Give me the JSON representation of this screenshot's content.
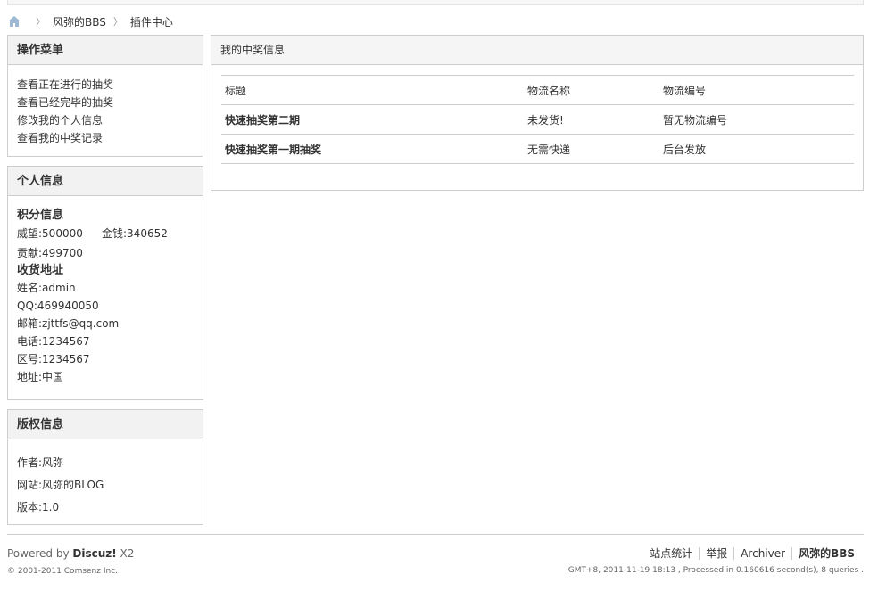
{
  "breadcrumb": {
    "site": "风弥的BBS",
    "current": "插件中心"
  },
  "menu": {
    "title": "操作菜单",
    "items": [
      "查看正在进行的抽奖",
      "查看已经完毕的抽奖",
      "修改我的个人信息",
      "查看我的中奖记录"
    ]
  },
  "info": {
    "title": "个人信息",
    "points_heading": "积分信息",
    "prestige": "威望:500000",
    "money": "金钱:340652",
    "contribution": "贡献:499700",
    "address_heading": "收货地址",
    "name": "姓名:admin",
    "qq": "QQ:469940050",
    "email": "邮箱:zjttfs@qq.com",
    "phone": "电话:1234567",
    "zone": "区号:1234567",
    "address": "地址:中国"
  },
  "copyright": {
    "title": "版权信息",
    "author": "作者:风弥",
    "site": "网站:风弥的BLOG",
    "version": "版本:1.0"
  },
  "main": {
    "title": "我的中奖信息",
    "columns": [
      "标题",
      "物流名称",
      "物流编号"
    ],
    "rows": [
      [
        "快速抽奖第二期",
        "未发货!",
        "暂无物流编号"
      ],
      [
        "快速抽奖第一期抽奖",
        "无需快递",
        "后台发放"
      ]
    ]
  },
  "footer": {
    "powered_prefix": "Powered by ",
    "powered_brand": "Discuz!",
    "powered_version": " X2",
    "copyright": "© 2001-2011 Comsenz Inc.",
    "links": [
      "站点统计",
      "举报",
      "Archiver",
      "风弥的BBS"
    ],
    "stats": "GMT+8, 2011-11-19 18:13 , Processed in 0.160616 second(s), 8 queries ."
  }
}
